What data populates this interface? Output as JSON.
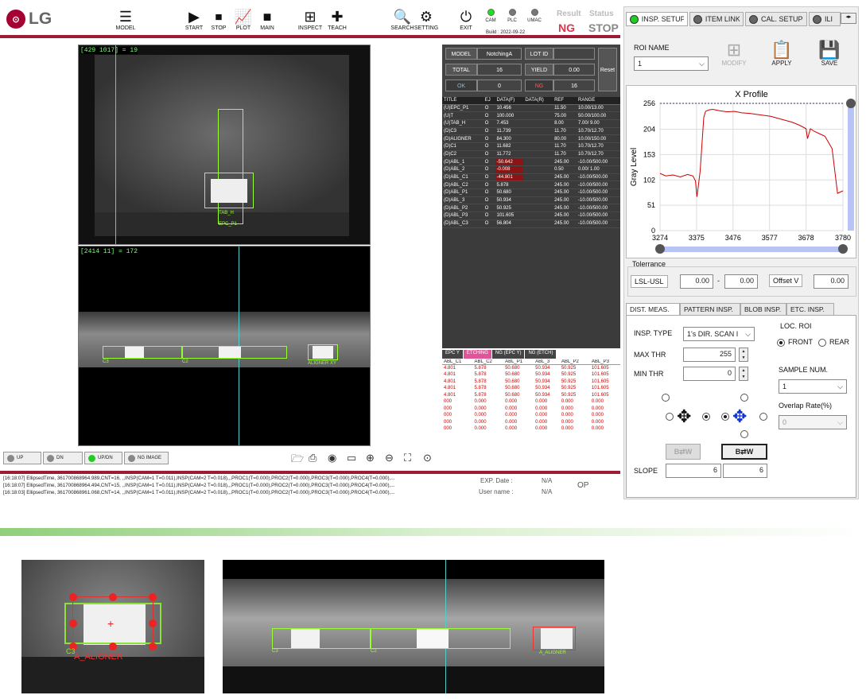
{
  "brand": "LG",
  "toolbar": {
    "items": [
      {
        "label": "MODEL",
        "icon": "model-icon"
      },
      {
        "label": "START",
        "icon": "play-icon"
      },
      {
        "label": "STOP",
        "icon": "stop-icon"
      },
      {
        "label": "PLOT",
        "icon": "chart-icon"
      },
      {
        "label": "MAIN",
        "icon": "camera-icon"
      },
      {
        "label": "INSPECT",
        "icon": "inspect-icon"
      },
      {
        "label": "TEACH",
        "icon": "plus-icon"
      },
      {
        "label": "SEARCH",
        "icon": "search-icon"
      },
      {
        "label": "SETTING",
        "icon": "settings-icon"
      },
      {
        "label": "EXIT",
        "icon": "power-icon"
      }
    ]
  },
  "status": {
    "leds": [
      {
        "label": "CAM",
        "on": true
      },
      {
        "label": "PLC",
        "on": false
      },
      {
        "label": "UMAC",
        "on": false
      }
    ],
    "build": "Build : 2022-09-22",
    "result_label": "Result",
    "result_value": "NG",
    "status_label": "Status",
    "status_value": "STOP"
  },
  "cam_top": {
    "readout": "[429 1017] = 19",
    "labels": [
      "TAB_H",
      "EPC_P1"
    ]
  },
  "cam_bottom": {
    "readout": "[2414 11] = 172",
    "labels": [
      "C3",
      "C2",
      "ALIGNER XY"
    ]
  },
  "stats": {
    "model_label": "MODEL",
    "model_value": "NotchingA",
    "lot_label": "LOT ID",
    "lot_value": "",
    "total_label": "TOTAL",
    "total_value": "16",
    "yield_label": "YIELD",
    "yield_value": "0.00",
    "ok_label": "OK",
    "ok_value": "0",
    "ng_label": "NG",
    "ng_value": "16",
    "reset_label": "Reset"
  },
  "results": {
    "headers": [
      "TITLE",
      "EJ",
      "DATA(F)",
      "DATA(R)",
      "REF",
      "RANGE"
    ],
    "rows": [
      [
        "(U)EPC_P1",
        "O",
        "10.456",
        "",
        "11.50",
        "10.00/13.00",
        false
      ],
      [
        "(U)T",
        "O",
        "100.000",
        "",
        "75.00",
        "50.00/100.00",
        false
      ],
      [
        "(U)TAB_H",
        "O",
        "7.453",
        "",
        "8.00",
        "7.00/ 9.00",
        false
      ],
      [
        "(D)C3",
        "O",
        "11.739",
        "",
        "11.70",
        "10.70/12.70",
        false
      ],
      [
        "(D)ALIGNER",
        "O",
        "84.300",
        "",
        "80.00",
        "10.00/150.00",
        false
      ],
      [
        "(D)C1",
        "O",
        "11.682",
        "",
        "11.70",
        "10.70/12.70",
        false
      ],
      [
        "(D)C2",
        "O",
        "11.772",
        "",
        "11.70",
        "10.70/12.70",
        false
      ],
      [
        "(D)ABL_1",
        "O",
        "-50.642",
        "",
        "245.00",
        "-10.00/500.00",
        true
      ],
      [
        "(D)ABL_2",
        "O",
        "-0.008",
        "",
        "0.50",
        "0.00/ 1.00",
        true
      ],
      [
        "(D)ABL_C1",
        "O",
        "-44.801",
        "",
        "245.00",
        "-10.00/500.00",
        true
      ],
      [
        "(D)ABL_C2",
        "O",
        "5.878",
        "",
        "245.00",
        "-10.00/500.00",
        false
      ],
      [
        "(D)ABL_P1",
        "O",
        "50.680",
        "",
        "245.00",
        "-10.00/500.00",
        false
      ],
      [
        "(D)ABL_3",
        "O",
        "50.934",
        "",
        "245.00",
        "-10.00/500.00",
        false
      ],
      [
        "(D)ABL_P2",
        "O",
        "50.925",
        "",
        "245.00",
        "-10.00/500.00",
        false
      ],
      [
        "(D)ABL_P3",
        "O",
        "101.605",
        "",
        "245.00",
        "-10.00/500.00",
        false
      ],
      [
        "(D)ABL_C3",
        "O",
        "56.804",
        "",
        "245.00",
        "-10.00/500.00",
        false
      ]
    ]
  },
  "bottom_tabs": [
    "EPC Y",
    "ETCHING",
    "NG (EPC Y)",
    "NG (ETCH)"
  ],
  "log_table": {
    "headers": [
      "ABL_C1",
      "ABL_C2",
      "ABL_P1",
      "ABL_3",
      "ABL_P2",
      "ABL_P3"
    ],
    "rows": [
      [
        "4.801",
        "5.878",
        "50.680",
        "50.934",
        "50.925",
        "101.605"
      ],
      [
        "4.801",
        "5.878",
        "50.680",
        "50.934",
        "50.925",
        "101.605"
      ],
      [
        "4.801",
        "5.878",
        "50.680",
        "50.934",
        "50.925",
        "101.605"
      ],
      [
        "4.801",
        "5.878",
        "50.680",
        "50.934",
        "50.925",
        "101.605"
      ],
      [
        "4.801",
        "5.878",
        "50.680",
        "50.934",
        "50.925",
        "101.605"
      ],
      [
        "000",
        "0.000",
        "0.000",
        "0.000",
        "0.000",
        "0.000"
      ],
      [
        "000",
        "0.000",
        "0.000",
        "0.000",
        "0.000",
        "0.000"
      ],
      [
        "000",
        "0.000",
        "0.000",
        "0.000",
        "0.000",
        "0.000"
      ],
      [
        "000",
        "0.000",
        "0.000",
        "0.000",
        "0.000",
        "0.000"
      ],
      [
        "000",
        "0.000",
        "0.000",
        "0.000",
        "0.000",
        "0.000"
      ]
    ]
  },
  "view_toggles": [
    {
      "label": "UP",
      "on": false
    },
    {
      "label": "DN",
      "on": false
    },
    {
      "label": "UP/DN",
      "on": true
    },
    {
      "label": "NG IMAGE",
      "on": false
    }
  ],
  "log_lines": [
    "[16:18:07] EllipsedTime, 361700868964.989,CNT=16, ,,INSP(CAM=1 T=0.011),INSP(CAM=2 T=0.018),,,PROC1(T=0.000),PROC2(T=0.000),PROC3(T=0.000),PROC4(T=0.000),...",
    "[16:18:07] EllipsedTime, 361700868964.494,CNT=15, ,,INSP(CAM=1 T=0.011),INSP(CAM=2 T=0.018),,,PROC1(T=0.000),PROC2(T=0.000),PROC3(T=0.000),PROC4(T=0.000),...",
    "[16:18:03] EllipsedTime, 361700868961.068,CNT=14, ,,INSP(CAM=1 T=0.011),INSP(CAM=2 T=0.018),,,PROC1(T=0.000),PROC2(T=0.000),PROC3(T=0.000),PROC4(T=0.000),..."
  ],
  "exp_info": {
    "exp_label": "EXP. Date :",
    "exp_value": "N/A",
    "user_label": "User name :",
    "user_value": "N/A",
    "role": "OP"
  },
  "right_panel": {
    "tabs": [
      {
        "label": "INSP. SETUP",
        "on": true
      },
      {
        "label": "ITEM LINK",
        "on": false
      },
      {
        "label": "CAL. SETUP",
        "on": false
      },
      {
        "label": "ILI",
        "on": false
      }
    ],
    "roi_label": "ROI NAME",
    "roi_value": "1",
    "actions": [
      {
        "label": "MODIFY",
        "icon": "modify-icon"
      },
      {
        "label": "APPLY",
        "icon": "apply-icon"
      },
      {
        "label": "SAVE",
        "icon": "save-icon"
      }
    ],
    "tolerance_label": "Tolerrance",
    "lsl_label": "LSL-USL",
    "lsl_value": "0.00",
    "dash": "-",
    "usl_value": "0.00",
    "offset_label": "Offset V",
    "offset_value": "0.00",
    "subtabs": [
      "DIST. MEAS.",
      "PATTERN INSP.",
      "BLOB INSP.",
      "ETC. INSP."
    ],
    "insp_type_label": "INSP. TYPE",
    "insp_type_value": "1's DIR. SCAN I",
    "max_thr_label": "MAX THR",
    "max_thr_value": "255",
    "min_thr_label": "MIN THR",
    "min_thr_value": "0",
    "loc_roi_label": "LOC. ROI",
    "front_label": "FRONT",
    "rear_label": "REAR",
    "sample_label": "SAMPLE NUM.",
    "sample_value": "1",
    "overlap_label": "Overlap Rate(%)",
    "overlap_value": "0",
    "bw_label": "B⇄W",
    "slope_label": "SLOPE",
    "slope_left": "6",
    "slope_right": "6"
  },
  "chart_data": {
    "type": "line",
    "title": "X Profile",
    "ylabel": "Gray Level",
    "xlim": [
      3274,
      3780
    ],
    "ylim": [
      0,
      256
    ],
    "xticks": [
      3274,
      3375,
      3476,
      3577,
      3678,
      3780
    ],
    "yticks": [
      0,
      51,
      102,
      153,
      204,
      256
    ],
    "series": [
      {
        "color": "#cc0000",
        "x": [
          3274,
          3290,
          3310,
          3330,
          3350,
          3365,
          3372,
          3376,
          3380,
          3385,
          3395,
          3400,
          3410,
          3420,
          3440,
          3460,
          3480,
          3500,
          3520,
          3540,
          3560,
          3580,
          3600,
          3620,
          3640,
          3660,
          3678,
          3682,
          3690,
          3700,
          3715,
          3730,
          3750,
          3765,
          3780
        ],
        "y": [
          115,
          110,
          112,
          108,
          113,
          110,
          100,
          68,
          90,
          120,
          228,
          240,
          243,
          244,
          241,
          239,
          240,
          237,
          236,
          234,
          232,
          230,
          226,
          222,
          218,
          212,
          205,
          185,
          205,
          200,
          195,
          190,
          165,
          75,
          80
        ]
      }
    ]
  },
  "annotations": {
    "crop1_label": "A_ALIGNER",
    "crop1_corner": "C3",
    "crop2_labels": [
      "C3",
      "C2",
      "A_ALIGNER"
    ]
  }
}
